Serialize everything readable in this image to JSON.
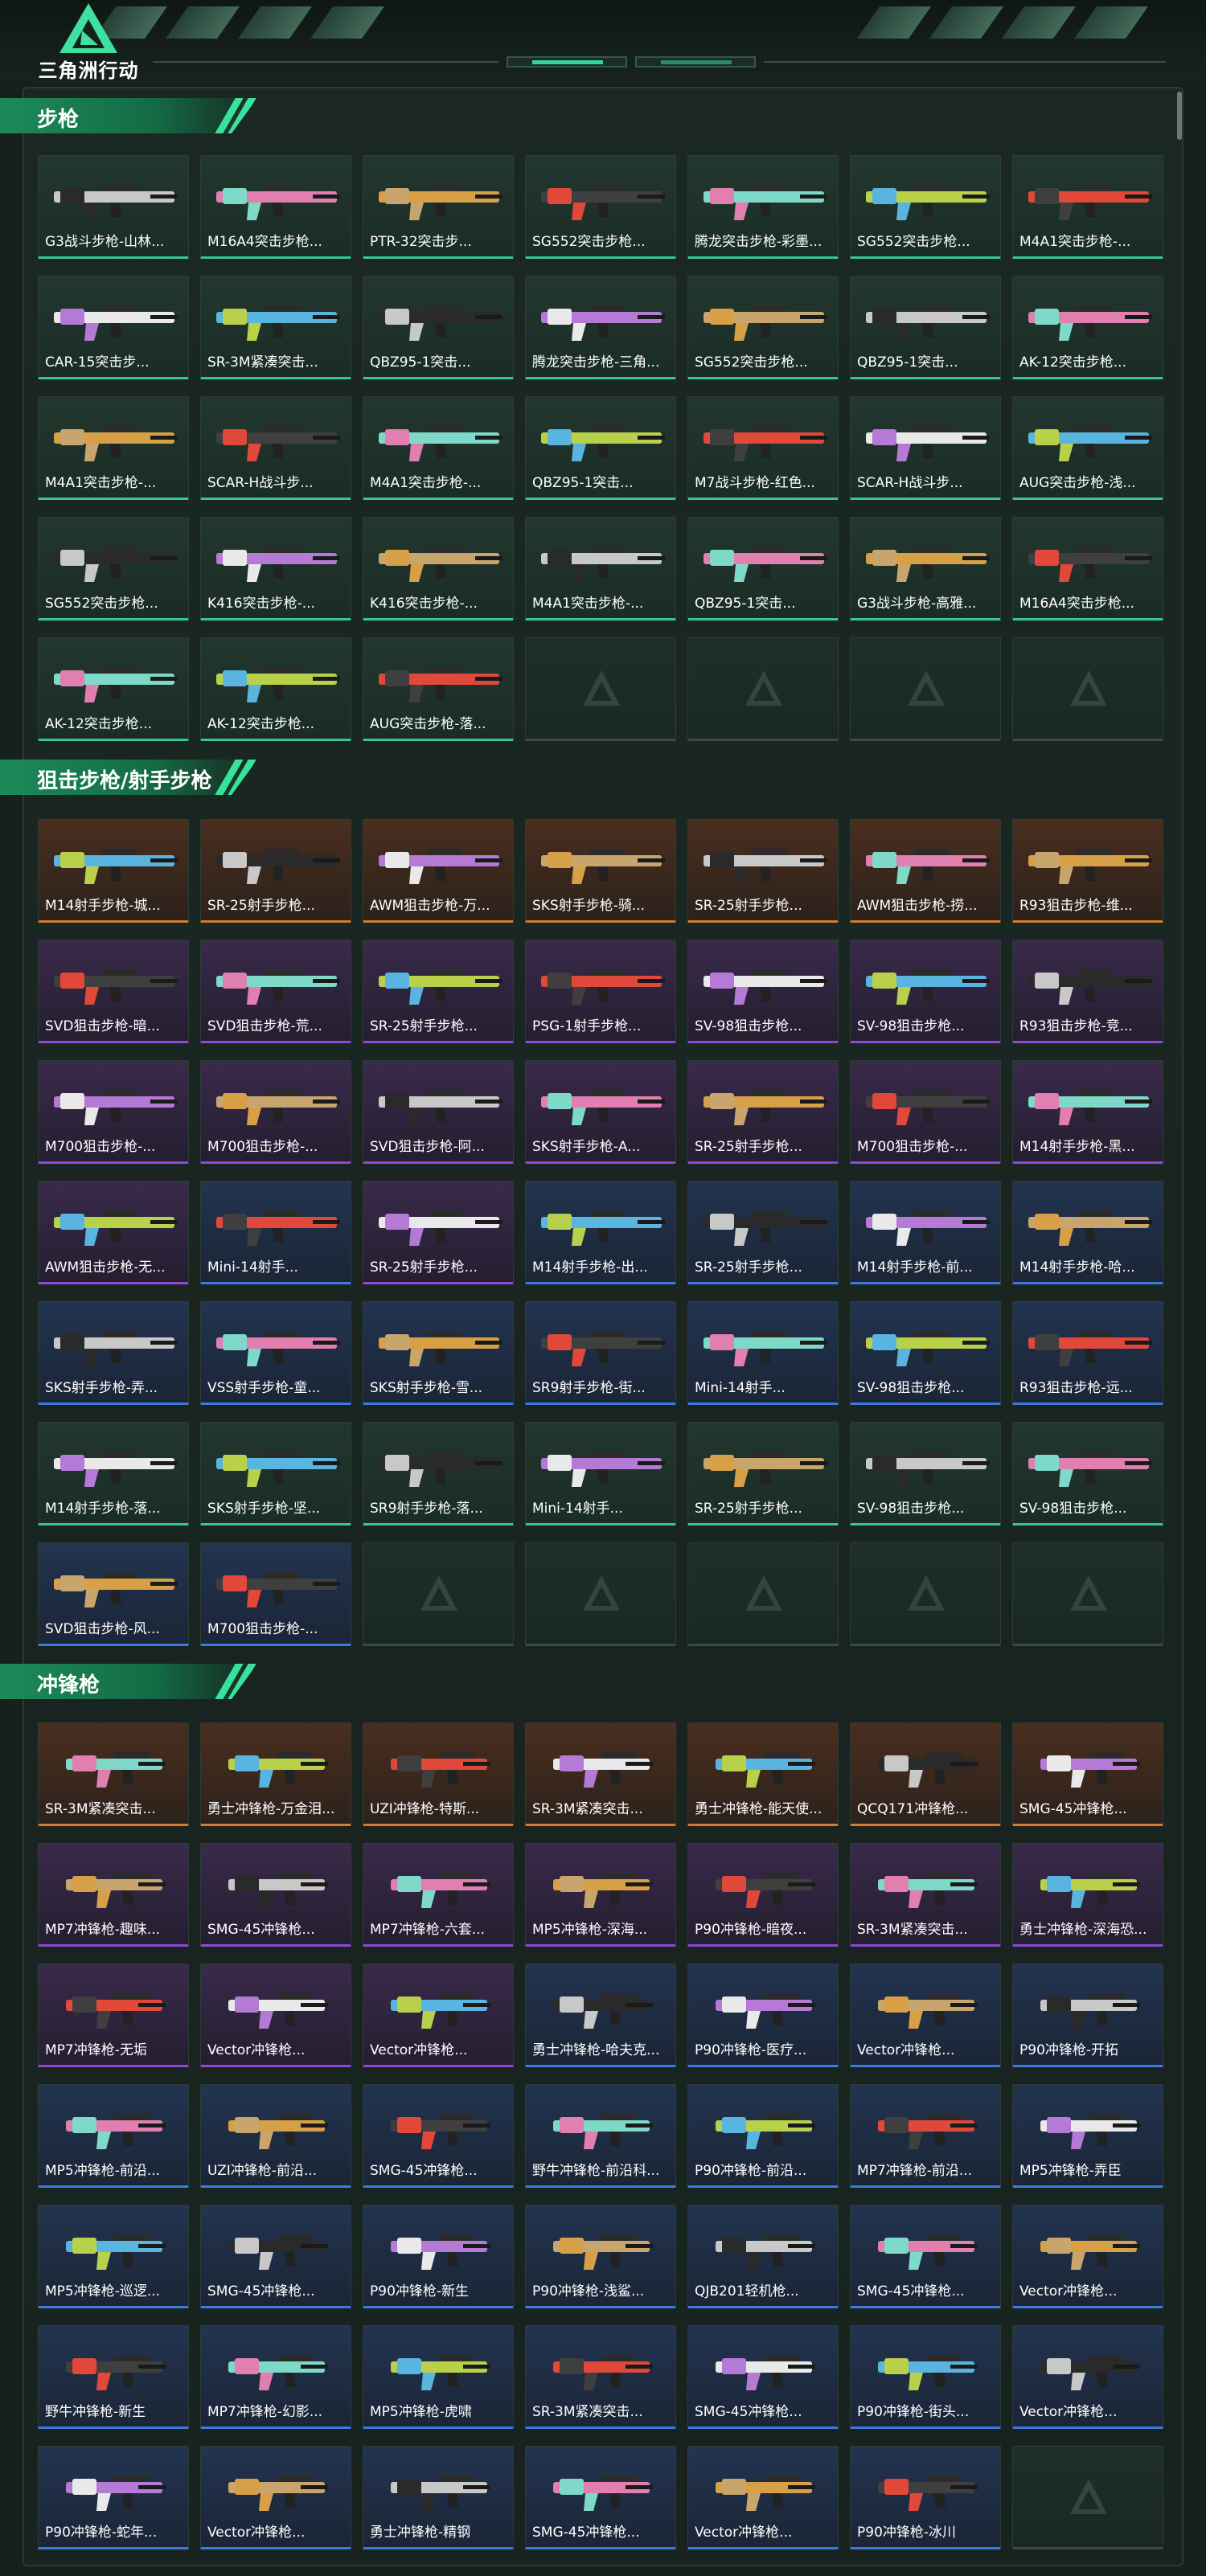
{
  "header": {
    "logo_text": "三角洲行动",
    "accent_color": "#35d59a"
  },
  "sections": [
    {
      "id": "rifles",
      "title": "步枪",
      "rarity_color": "#35c98c",
      "items": [
        "G3战斗步枪-山林...",
        "M16A4突击步枪...",
        "PTR-32突击步...",
        "SG552突击步枪...",
        "腾龙突击步枪-彩墨...",
        "SG552突击步枪...",
        "M4A1突击步枪-...",
        "CAR-15突击步...",
        "SR-3M紧凑突击...",
        "QBZ95-1突击...",
        "腾龙突击步枪-三角...",
        "SG552突击步枪...",
        "QBZ95-1突击...",
        "AK-12突击步枪...",
        "M4A1突击步枪-...",
        "SCAR-H战斗步...",
        "M4A1突击步枪-...",
        "QBZ95-1突击...",
        "M7战斗步枪-红色...",
        "SCAR-H战斗步...",
        "AUG突击步枪-浅...",
        "SG552突击步枪...",
        "K416突击步枪-...",
        "K416突击步枪-...",
        "M4A1突击步枪-...",
        "QBZ95-1突击...",
        "G3战斗步枪-高雅...",
        "M16A4突击步枪...",
        "AK-12突击步枪...",
        "AK-12突击步枪...",
        "AUG突击步枪-落...",
        "",
        "",
        "",
        ""
      ]
    },
    {
      "id": "snipers",
      "title": "狙击步枪/射手步枪",
      "items": [
        "M14射手步枪-城...",
        "SR-25射手步枪...",
        "AWM狙击步枪-万...",
        "SKS射手步枪-骑...",
        "SR-25射手步枪...",
        "AWM狙击步枪-捞...",
        "R93狙击步枪-维...",
        "SVD狙击步枪-暗...",
        "SVD狙击步枪-荒...",
        "SR-25射手步枪...",
        "PSG-1射手步枪...",
        "SV-98狙击步枪...",
        "SV-98狙击步枪...",
        "R93狙击步枪-竞...",
        "M700狙击步枪-...",
        "M700狙击步枪-...",
        "SVD狙击步枪-阿...",
        "SKS射手步枪-A...",
        "SR-25射手步枪...",
        "M700狙击步枪-...",
        "M14射手步枪-黑...",
        "AWM狙击步枪-无...",
        "Mini-14射手...",
        "SR-25射手步枪...",
        "M14射手步枪-出...",
        "SR-25射手步枪...",
        "M14射手步枪-前...",
        "M14射手步枪-哈...",
        "SKS射手步枪-弄...",
        "VSS射手步枪-童...",
        "SKS射手步枪-雪...",
        "SR9射手步枪-街...",
        "Mini-14射手...",
        "SV-98狙击步枪...",
        "R93狙击步枪-远...",
        "M14射手步枪-落...",
        "SKS射手步枪-坚...",
        "SR9射手步枪-落...",
        "Mini-14射手...",
        "SR-25射手步枪...",
        "SV-98狙击步枪...",
        "SV-98狙击步枪...",
        "SVD狙击步枪-风...",
        "M700狙击步枪-...",
        "",
        "",
        "",
        "",
        ""
      ],
      "rarity": [
        "orange",
        "orange",
        "orange",
        "orange",
        "orange",
        "orange",
        "orange",
        "purple",
        "purple",
        "purple",
        "purple",
        "purple",
        "purple",
        "purple",
        "purple",
        "purple",
        "purple",
        "purple",
        "purple",
        "purple",
        "purple",
        "purple",
        "blue",
        "purple",
        "blue",
        "blue",
        "blue",
        "blue",
        "blue",
        "blue",
        "blue",
        "blue",
        "blue",
        "blue",
        "blue",
        "green",
        "green",
        "green",
        "green",
        "green",
        "green",
        "green",
        "blue",
        "blue",
        "empty",
        "empty",
        "empty",
        "empty",
        "empty"
      ]
    },
    {
      "id": "smgs",
      "title": "冲锋枪",
      "items": [
        "SR-3M紧凑突击...",
        "勇士冲锋枪-万金泪...",
        "UZI冲锋枪-特斯...",
        "SR-3M紧凑突击...",
        "勇士冲锋枪-能天使...",
        "QCQ171冲锋枪...",
        "SMG-45冲锋枪...",
        "MP7冲锋枪-趣味...",
        "SMG-45冲锋枪...",
        "MP7冲锋枪-六套...",
        "MP5冲锋枪-深海...",
        "P90冲锋枪-暗夜...",
        "SR-3M紧凑突击...",
        "勇士冲锋枪-深海恐...",
        "MP7冲锋枪-无垢",
        "Vector冲锋枪...",
        "Vector冲锋枪...",
        "勇士冲锋枪-哈夫克...",
        "P90冲锋枪-医疗...",
        "Vector冲锋枪...",
        "P90冲锋枪-开拓",
        "MP5冲锋枪-前沿...",
        "UZI冲锋枪-前沿...",
        "SMG-45冲锋枪...",
        "野牛冲锋枪-前沿科...",
        "P90冲锋枪-前沿...",
        "MP7冲锋枪-前沿...",
        "MP5冲锋枪-弄臣",
        "MP5冲锋枪-巡逻...",
        "SMG-45冲锋枪...",
        "P90冲锋枪-新生",
        "P90冲锋枪-浅鲨...",
        "QJB201轻机枪...",
        "SMG-45冲锋枪...",
        "Vector冲锋枪...",
        "野牛冲锋枪-新生",
        "MP7冲锋枪-幻影...",
        "MP5冲锋枪-虎啸",
        "SR-3M紧凑突击...",
        "SMG-45冲锋枪...",
        "P90冲锋枪-街头...",
        "Vector冲锋枪...",
        "P90冲锋枪-蛇年...",
        "Vector冲锋枪...",
        "勇士冲锋枪-精钢",
        "SMG-45冲锋枪...",
        "Vector冲锋枪...",
        "P90冲锋枪-冰川",
        ""
      ],
      "rarity": [
        "orange",
        "orange",
        "orange",
        "orange",
        "orange",
        "orange",
        "orange",
        "purple",
        "purple",
        "purple",
        "purple",
        "purple",
        "purple",
        "purple",
        "purple",
        "purple",
        "purple",
        "blue",
        "blue",
        "blue",
        "blue",
        "blue",
        "blue",
        "blue",
        "blue",
        "blue",
        "blue",
        "blue",
        "blue",
        "blue",
        "blue",
        "blue",
        "blue",
        "blue",
        "blue",
        "blue",
        "blue",
        "blue",
        "blue",
        "blue",
        "blue",
        "blue",
        "blue",
        "blue",
        "blue",
        "blue",
        "blue",
        "blue",
        "empty"
      ]
    }
  ],
  "colors": {
    "orange": "#d97a2b",
    "purple": "#8b4ad6",
    "blue": "#3b7be0",
    "green": "#35c98c"
  }
}
